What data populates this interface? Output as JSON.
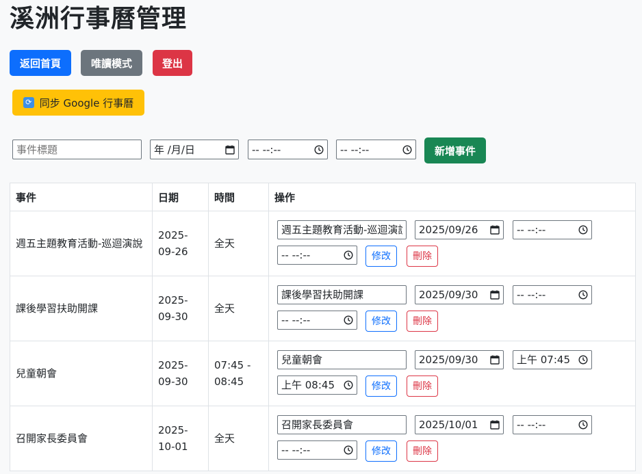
{
  "header": {
    "title": "溪洲行事曆管理"
  },
  "nav": {
    "home_label": "返回首頁",
    "readonly_label": "唯讀模式",
    "logout_label": "登出",
    "sync_label": "同步 Google 行事曆",
    "sync_icon": "refresh-icon"
  },
  "add_form": {
    "title_placeholder": "事件標題",
    "date_value": "年 /月/日",
    "start_time_value": "-- --:--",
    "end_time_value": "-- --:--",
    "add_label": "新增事件"
  },
  "table": {
    "headers": [
      "事件",
      "日期",
      "時間",
      "操作"
    ],
    "rows": [
      {
        "event": "週五主題教育活動-巡迴演說",
        "date": "2025-09-26",
        "time": "全天",
        "edit_title": "週五主題教育活動-巡迴演說",
        "edit_date": "2025/09/26",
        "edit_start": "-- --:--",
        "edit_end": "-- --:--",
        "edit_label": "修改",
        "delete_label": "刪除"
      },
      {
        "event": "課後學習扶助開課",
        "date": "2025-09-30",
        "time": "全天",
        "edit_title": "課後學習扶助開課",
        "edit_date": "2025/09/30",
        "edit_start": "-- --:--",
        "edit_end": "-- --:--",
        "edit_label": "修改",
        "delete_label": "刪除"
      },
      {
        "event": "兒童朝會",
        "date": "2025-09-30",
        "time": "07:45 - 08:45",
        "edit_title": "兒童朝會",
        "edit_date": "2025/09/30",
        "edit_start": "上午 07:45",
        "edit_end": "上午 08:45",
        "edit_label": "修改",
        "delete_label": "刪除"
      },
      {
        "event": "召開家長委員會",
        "date": "2025-10-01",
        "time": "全天",
        "edit_title": "召開家長委員會",
        "edit_date": "2025/10/01",
        "edit_start": "-- --:--",
        "edit_end": "-- --:--",
        "edit_label": "修改",
        "delete_label": "刪除"
      }
    ]
  }
}
